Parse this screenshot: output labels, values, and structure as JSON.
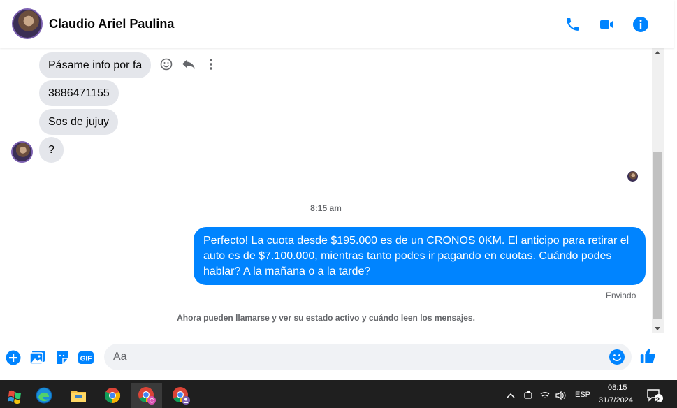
{
  "header": {
    "contact_name": "Claudio Ariel Paulina",
    "icons": [
      "phone-icon",
      "video-call-icon",
      "info-icon"
    ],
    "accent_color": "#0084ff"
  },
  "messages": {
    "incoming": [
      "Pásame info por fa",
      "3886471155",
      "Sos de jujuy",
      "?"
    ],
    "timestamp": "8:15 am",
    "outgoing": "Perfecto! La cuota desde $195.000 es de un CRONOS 0KM. El anticipo para retirar el auto es de $7.100.000, mientras tanto podes ir pagando en cuotas. Cuándo podes hablar? A la mañana o a la tarde?",
    "sent_status": "Enviado",
    "system_note": "Ahora pueden llamarse y ver su estado activo y cuándo leen los mensajes."
  },
  "composer": {
    "placeholder": "Aa",
    "icons": [
      "add-icon",
      "image-icon",
      "sticker-icon",
      "gif-icon",
      "emoji-icon",
      "like-icon"
    ],
    "gif_label": "GIF"
  },
  "taskbar": {
    "apps": [
      "windows-start-icon",
      "edge-icon",
      "file-explorer-icon",
      "chrome-icon",
      "chrome-profile-c-icon",
      "chrome-profile-icon"
    ],
    "language": "ESP",
    "time": "08:15",
    "date": "31/7/2024",
    "notification_count": "2"
  }
}
